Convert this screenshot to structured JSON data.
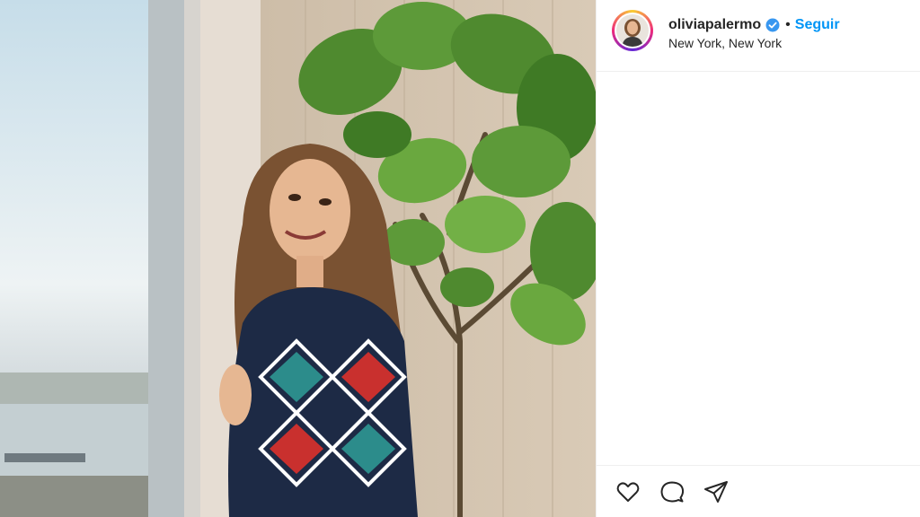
{
  "post": {
    "image_alt": "Woman smiling by a window next to a fiddle-leaf fig plant",
    "icons": [
      "like-icon",
      "comment-icon",
      "share-icon"
    ]
  },
  "header": {
    "username": "oliviapalermo",
    "separator": "•",
    "follow_label": "Seguir",
    "location": "New York, New York",
    "verified": true
  },
  "colors": {
    "follow": "#0095f6",
    "verified": "#3897f0",
    "text": "#262626",
    "border": "#efefef"
  }
}
